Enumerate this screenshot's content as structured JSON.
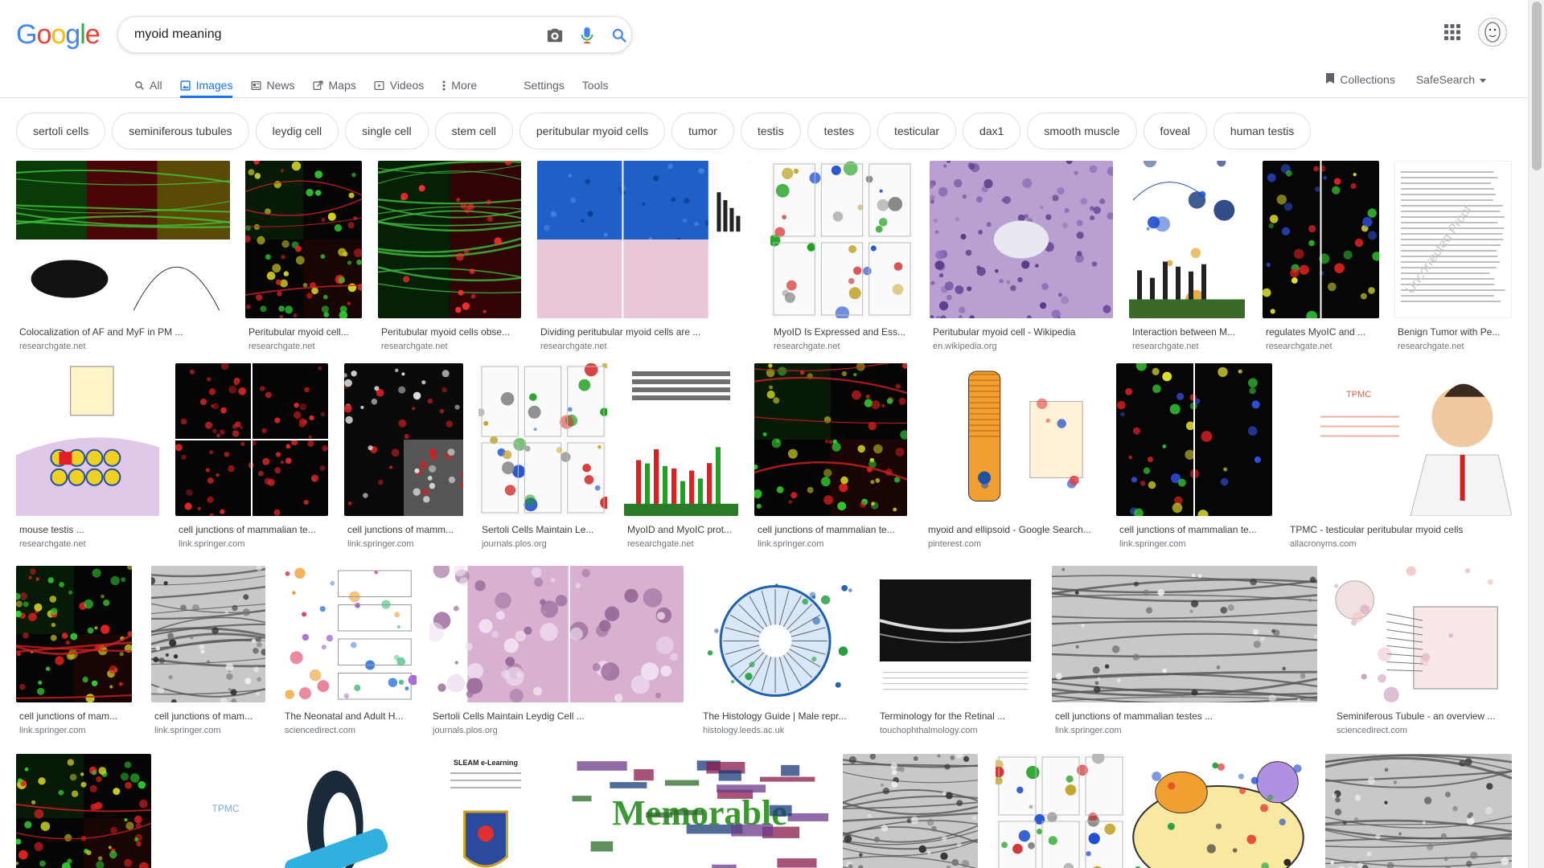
{
  "logo": {
    "text": "Google"
  },
  "search": {
    "value": "myoid meaning"
  },
  "tabs": [
    {
      "label": "All",
      "icon": "search-icon",
      "active": false
    },
    {
      "label": "Images",
      "icon": "image-icon",
      "active": true
    },
    {
      "label": "News",
      "icon": "news-icon",
      "active": false
    },
    {
      "label": "Maps",
      "icon": "map-icon",
      "active": false
    },
    {
      "label": "Videos",
      "icon": "video-icon",
      "active": false
    },
    {
      "label": "More",
      "icon": "more-vert-icon",
      "active": false
    }
  ],
  "tools": {
    "settings": "Settings",
    "tools": "Tools"
  },
  "right_tools": {
    "collections": "Collections",
    "safesearch": "SafeSearch"
  },
  "chips": [
    "sertoli cells",
    "seminiferous tubules",
    "leydig cell",
    "single cell",
    "stem cell",
    "peritubular myoid cells",
    "tumor",
    "testis",
    "testes",
    "testicular",
    "dax1",
    "smooth muscle",
    "foveal",
    "human testis"
  ],
  "results": [
    [
      {
        "caption": "Colocalization of AF and MyF in PM ...",
        "source": "researchgate.net",
        "style": "fluor-grid"
      },
      {
        "caption": "Peritubular myoid cell...",
        "source": "researchgate.net",
        "style": "fluor-red-green"
      },
      {
        "caption": "Peritubular myoid cells obse...",
        "source": "researchgate.net",
        "style": "fluor-split"
      },
      {
        "caption": "Dividing peritubular myoid cells are ...",
        "source": "researchgate.net",
        "style": "blue-histo"
      },
      {
        "caption": "MyoID Is Expressed and Ess...",
        "source": "researchgate.net",
        "style": "figure-mixed"
      },
      {
        "caption": "Peritubular myoid cell - Wikipedia",
        "source": "en.wikipedia.org",
        "style": "purple-histo"
      },
      {
        "caption": "Interaction between M...",
        "source": "researchgate.net",
        "style": "chart-mixed"
      },
      {
        "caption": "regulates MyoIC and ...",
        "source": "researchgate.net",
        "style": "fluor-dark"
      },
      {
        "caption": "Benign Tumor with Pe...",
        "source": "researchgate.net",
        "style": "paper"
      }
    ],
    [
      {
        "caption": "mouse testis ...",
        "source": "researchgate.net",
        "style": "diagram-cells"
      },
      {
        "caption": "cell junctions of mammalian te...",
        "source": "link.springer.com",
        "style": "fluor-red"
      },
      {
        "caption": "cell junctions of mamm...",
        "source": "link.springer.com",
        "style": "fluor-red-gray"
      },
      {
        "caption": "Sertoli Cells Maintain Le...",
        "source": "journals.plos.org",
        "style": "figure-mixed"
      },
      {
        "caption": "MyoID and MyoIC prot...",
        "source": "researchgate.net",
        "style": "blot-bars"
      },
      {
        "caption": "cell junctions of mammalian te...",
        "source": "link.springer.com",
        "style": "fluor-red-green"
      },
      {
        "caption": "myoid and ellipsoid - Google Search...",
        "source": "pinterest.com",
        "style": "diagram-retina"
      },
      {
        "caption": "cell junctions of mammalian te...",
        "source": "link.springer.com",
        "style": "fluor-dark"
      },
      {
        "caption": "TPMC - testicular peritubular myoid cells",
        "source": "allacronyms.com",
        "style": "doctor"
      }
    ],
    [
      {
        "caption": "cell junctions of mam...",
        "source": "link.springer.com",
        "style": "fluor-red-green"
      },
      {
        "caption": "cell junctions of mam...",
        "source": "link.springer.com",
        "style": "em-gray"
      },
      {
        "caption": "The Neonatal and Adult H...",
        "source": "sciencedirect.com",
        "style": "diagram-flow"
      },
      {
        "caption": "Sertoli Cells Maintain Leydig Cell ...",
        "source": "journals.plos.org",
        "style": "pink-histo"
      },
      {
        "caption": "The Histology Guide | Male repr...",
        "source": "histology.leeds.ac.uk",
        "style": "tubule-diagram"
      },
      {
        "caption": "Terminology for the Retinal ...",
        "source": "touchophthalmology.com",
        "style": "oct"
      },
      {
        "caption": "cell junctions of mammalian testes ...",
        "source": "link.springer.com",
        "style": "em-gray"
      },
      {
        "caption": "Seminiferous Tubule - an overview ...",
        "source": "sciencedirect.com",
        "style": "tubule-anat"
      }
    ],
    [
      {
        "caption": "",
        "source": "",
        "style": "fluor-red-green"
      },
      {
        "caption": "",
        "source": "",
        "style": "penguin",
        "text": "TPMC"
      },
      {
        "caption": "",
        "source": "",
        "style": "badge",
        "text": "SLEAM e-Learning"
      },
      {
        "caption": "",
        "source": "",
        "style": "wordcloud",
        "text": "Memorable"
      },
      {
        "caption": "",
        "source": "",
        "style": "em-gray"
      },
      {
        "caption": "",
        "source": "",
        "style": "figure-mixed"
      },
      {
        "caption": "",
        "source": "",
        "style": "cartoon-cell"
      },
      {
        "caption": "",
        "source": "",
        "style": "em-gray"
      }
    ]
  ]
}
